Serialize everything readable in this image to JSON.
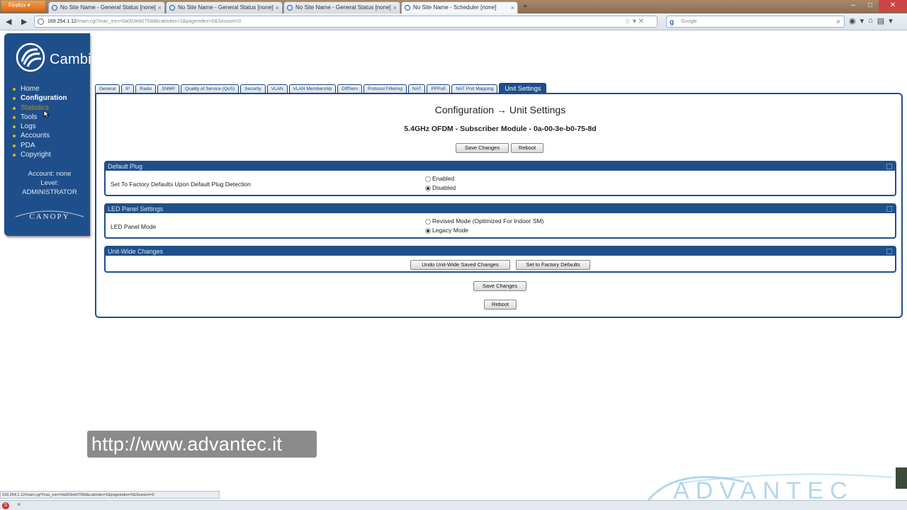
{
  "browser": {
    "menu_button": "Firefox",
    "tabs": [
      {
        "title": "No Site Name - General Status [none]"
      },
      {
        "title": "No Site Name - General Status [none]"
      },
      {
        "title": "No Site Name - General Status [none]"
      },
      {
        "title": "No Site Name - Scheduler [none]"
      }
    ],
    "url_host": "169.254.1.12",
    "url_path": "/main.cgi?mac_esn=0a003eb0758d&catindex=2&pageindex=0&Session=0",
    "search_placeholder": "Google"
  },
  "sidebar": {
    "brand": "Cambium Networks",
    "menu": [
      {
        "label": "Home"
      },
      {
        "label": "Configuration"
      },
      {
        "label": "Statistics"
      },
      {
        "label": "Tools"
      },
      {
        "label": "Logs"
      },
      {
        "label": "Accounts"
      },
      {
        "label": "PDA"
      },
      {
        "label": "Copyright"
      }
    ],
    "account_line": "Account: none",
    "level_line": "Level:",
    "level_value": "ADMINISTRATOR",
    "canopy_logo_text": "CANOPY"
  },
  "config_tabs": [
    {
      "label": "General"
    },
    {
      "label": "IP"
    },
    {
      "label": "Radio"
    },
    {
      "label": "SNMP"
    },
    {
      "label": "Quality of Service (QoS)"
    },
    {
      "label": "Security"
    },
    {
      "label": "VLAN"
    },
    {
      "label": "VLAN Membership"
    },
    {
      "label": "DiffServ"
    },
    {
      "label": "Protocol Filtering"
    },
    {
      "label": "NAT"
    },
    {
      "label": "PPPoE"
    },
    {
      "label": "NAT Port Mapping"
    },
    {
      "label": "Unit Settings"
    }
  ],
  "page": {
    "title": "Configuration → Unit Settings",
    "subtitle": "5.4GHz OFDM - Subscriber Module - 0a-00-3e-b0-75-8d",
    "save_changes": "Save Changes",
    "reboot": "Reboot"
  },
  "sections": {
    "default_plug": {
      "header": "Default Plug",
      "label": "Set To Factory Defaults Upon Default Plug Detection",
      "option_1": "Enabled",
      "option_2": "Disabled",
      "selected": "Disabled"
    },
    "led_panel": {
      "header": "LED Panel Settings",
      "label": "LED Panel Mode",
      "option_1": "Revised Mode (Optimized For Indoor SM)",
      "option_2": "Legacy Mode",
      "selected": "Legacy Mode"
    },
    "unit_wide": {
      "header": "Unit-Wide Changes",
      "undo_button": "Undo Unit-Wide Saved Changes",
      "factory_button": "Set to Factory Defaults"
    }
  },
  "overlay": {
    "watermark_url": "http://www.advantec.it",
    "logo_text": "ADVANTEC"
  },
  "statusbar": {
    "text": "169.254.1.12/main.cgi?mac_esn=0a003eb0758d&catindex=2&pageindex=0&Session=0"
  },
  "colors": {
    "brand_blue": "#1f4f8a",
    "menu_bullet": "#e0b800",
    "firefox_orange": "#e07a2a"
  }
}
